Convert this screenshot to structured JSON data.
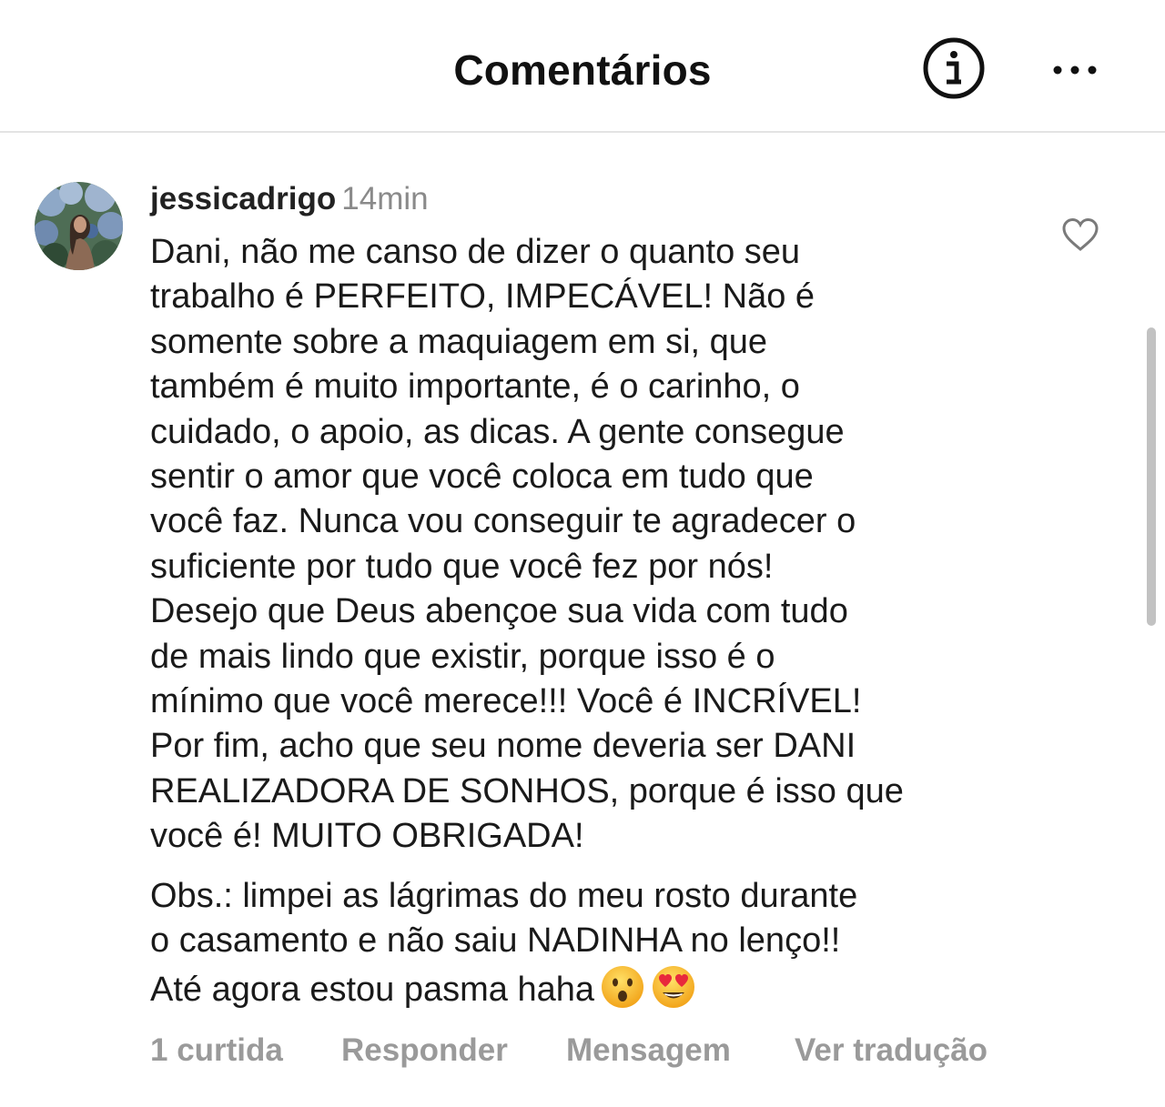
{
  "header": {
    "title": "Comentários"
  },
  "comment": {
    "username": "jessicadrigo",
    "time": "14min",
    "paragraph1": "Dani, não me canso de dizer o quanto seu\ntrabalho é PERFEITO, IMPECÁVEL! Não é\nsomente sobre a maquiagem em si, que\ntambém é muito importante, é o carinho, o\ncuidado, o apoio, as dicas. A gente consegue\nsentir o amor que você coloca em tudo que\nvocê faz. Nunca vou conseguir te agradecer o\nsuficiente por tudo que você fez por nós!\nDesejo que Deus abençoe sua vida com tudo\nde mais lindo que existir, porque isso é o\nmínimo que você merece!!! Você é INCRÍVEL!\nPor fim, acho que seu nome deveria ser DANI\nREALIZADORA DE SONHOS, porque é isso que\nvocê é! MUITO OBRIGADA!",
    "paragraph2": "Obs.: limpei as lágrimas do meu rosto durante\no casamento e não saiu NADINHA no lenço!!\nAté agora estou pasma haha",
    "emojis": [
      "astonished-face",
      "heart-eyes-face"
    ]
  },
  "actions": {
    "likes": "1 curtida",
    "reply": "Responder",
    "message": "Mensagem",
    "translate": "Ver tradução"
  },
  "icons": {
    "info": "info-circle-icon",
    "more": "more-dots-icon",
    "like": "heart-outline-icon"
  },
  "colors": {
    "text": "#111111",
    "secondary": "#8a8a8a",
    "divider": "#e3e3e3"
  }
}
